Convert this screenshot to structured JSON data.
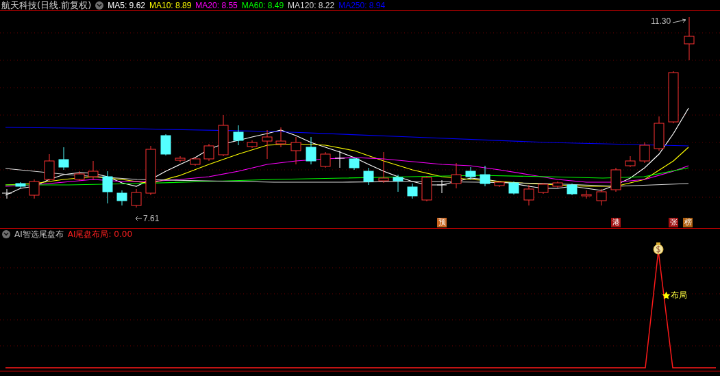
{
  "title": "航天科技(日线.前复权)",
  "ma_legend": [
    {
      "label": "MA5: 9.62",
      "color": "#ffffff"
    },
    {
      "label": "MA10: 8.89",
      "color": "#ffff00"
    },
    {
      "label": "MA20: 8.55",
      "color": "#ff00ff"
    },
    {
      "label": "MA60: 8.49",
      "color": "#00ff00"
    },
    {
      "label": "MA120: 8.22",
      "color": "#d8d8d8"
    },
    {
      "label": "MA250: 8.94",
      "color": "#0000ff"
    }
  ],
  "price_labels": {
    "high": "11.30",
    "low": "7.61"
  },
  "markers": [
    {
      "text": "预",
      "color": "#c8641e"
    },
    {
      "text": "港",
      "color": "#a01010"
    },
    {
      "text": "张",
      "color": "#a01010"
    },
    {
      "text": "榜",
      "color": "#b06010"
    }
  ],
  "indicator": {
    "name": "AI智选尾盘布",
    "value_label": "AI尾盘布局: 0.00",
    "signal_label": "布局"
  }
}
